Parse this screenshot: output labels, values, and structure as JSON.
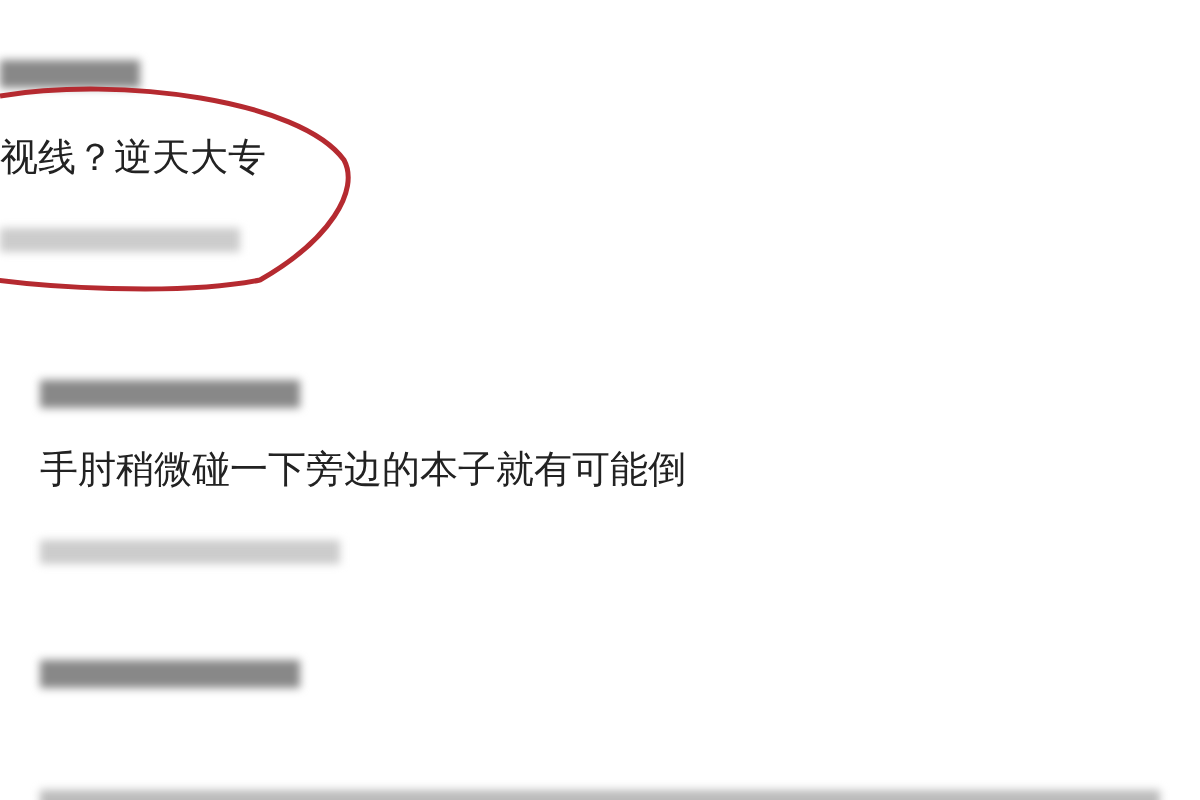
{
  "comments": [
    {
      "text": "视线？逆天大专",
      "highlighted": true
    },
    {
      "text": "手肘稍微碰一下旁边的本子就有可能倒",
      "highlighted": false
    },
    {
      "highlighted": false
    }
  ]
}
